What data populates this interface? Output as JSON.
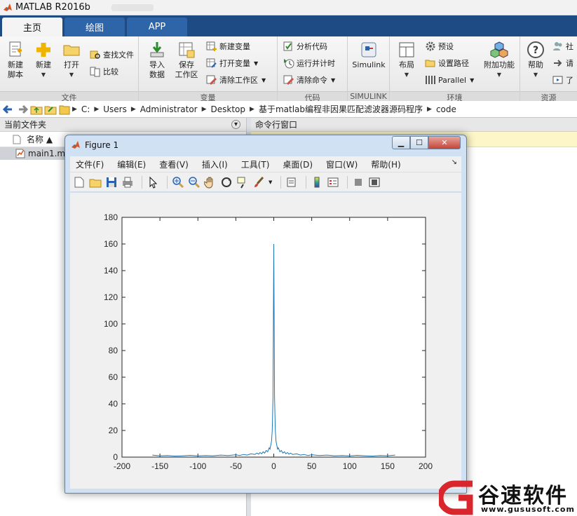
{
  "app": {
    "title": "MATLAB R2016b"
  },
  "tabs": [
    {
      "label": "主页"
    },
    {
      "label": "绘图"
    },
    {
      "label": "APP"
    }
  ],
  "ribbon": {
    "file": {
      "label": "文件",
      "new_script": "新建\n脚本",
      "new": "新建",
      "open": "打开",
      "find_files": "查找文件",
      "compare": "比较"
    },
    "variable": {
      "label": "变量",
      "import_data": "导入\n数据",
      "save_workspace": "保存\n工作区",
      "new_variable": "新建变量",
      "open_variable": "打开变量",
      "clear_workspace": "清除工作区"
    },
    "code": {
      "label": "代码",
      "analyze_code": "分析代码",
      "run_and_time": "运行并计时",
      "clear_commands": "清除命令"
    },
    "simulink": {
      "label": "SIMULINK",
      "simulink": "Simulink"
    },
    "environment": {
      "label": "环境",
      "layout": "布局",
      "preferences": "预设",
      "set_path": "设置路径",
      "parallel": "Parallel",
      "add_ons": "附加功能"
    },
    "resources": {
      "label": "资源",
      "help": "帮助",
      "community": "社",
      "request": "请",
      "learn": "了"
    }
  },
  "address": {
    "crumbs": [
      "C:",
      "Users",
      "Administrator",
      "Desktop",
      "基于matlab编程非因果匹配滤波器源码程序",
      "code"
    ]
  },
  "left_panel": {
    "title": "当前文件夹",
    "col_name": "名称 ▲",
    "files": [
      {
        "name": "main1.m"
      }
    ]
  },
  "right_panel": {
    "title": "命令行窗口"
  },
  "figure": {
    "title": "Figure 1",
    "menu": [
      "文件(F)",
      "编辑(E)",
      "查看(V)",
      "插入(I)",
      "工具(T)",
      "桌面(D)",
      "窗口(W)",
      "帮助(H)"
    ]
  },
  "chart_data": {
    "type": "line",
    "title": "",
    "xlabel": "",
    "ylabel": "",
    "xlim": [
      -200,
      200
    ],
    "ylim": [
      0,
      180
    ],
    "xticks": [
      -200,
      -150,
      -100,
      -50,
      0,
      50,
      100,
      150,
      200
    ],
    "yticks": [
      0,
      20,
      40,
      60,
      80,
      100,
      120,
      140,
      160,
      180
    ],
    "grid": false,
    "color": "#1f77b4",
    "series": [
      {
        "x": [
          -160,
          -150,
          -140,
          -130,
          -120,
          -110,
          -100,
          -90,
          -80,
          -70,
          -60,
          -50,
          -45,
          -40,
          -35,
          -30,
          -25,
          -22,
          -20,
          -18,
          -16,
          -14,
          -12,
          -10,
          -8,
          -6,
          -5,
          -4,
          -3,
          -2,
          -1,
          0,
          1,
          2,
          3,
          4,
          5,
          6,
          8,
          10,
          12,
          14,
          16,
          18,
          20,
          22,
          25,
          30,
          35,
          40,
          45,
          50,
          60,
          70,
          80,
          90,
          100,
          110,
          120,
          130,
          140,
          150,
          160
        ],
        "y": [
          1.5,
          1,
          1.2,
          0.8,
          1,
          1.3,
          0.9,
          1.2,
          1,
          1.5,
          1.2,
          1.8,
          1.2,
          2,
          1.5,
          2.5,
          2,
          3,
          2.2,
          3.5,
          2.5,
          4,
          3,
          5,
          4,
          7,
          6,
          9,
          12,
          20,
          45,
          160,
          45,
          20,
          12,
          9,
          6,
          7,
          4,
          5,
          3,
          4,
          2.5,
          3.5,
          2.2,
          3,
          2,
          2.5,
          1.5,
          2,
          1.2,
          1.8,
          1.2,
          1.5,
          1,
          1.2,
          0.9,
          1.3,
          1,
          0.8,
          1.2,
          1,
          1.5
        ]
      }
    ]
  },
  "watermark": {
    "main": "谷速软件",
    "url": "www.gususoft.com"
  },
  "colors": {
    "tab_bar": "#1e4b84",
    "plot_line": "#1f77b4",
    "watermark_red": "#d9262c"
  }
}
